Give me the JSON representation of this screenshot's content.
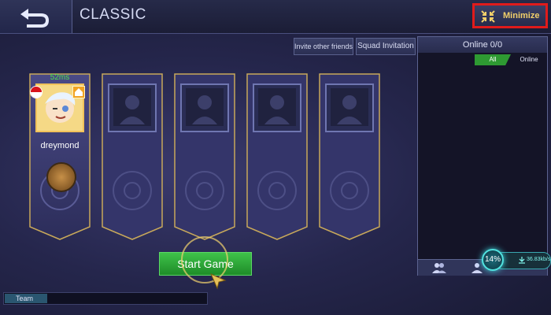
{
  "header": {
    "title": "CLASSIC",
    "minimize_label": "Minimize"
  },
  "invites": {
    "invite_friends_label": "Invite other friends",
    "squad_invitation_label": "Squad Invitation"
  },
  "online_panel": {
    "title": "Online 0/0",
    "tabs": [
      {
        "label": "All",
        "active": true
      },
      {
        "label": "Online",
        "active": false
      }
    ]
  },
  "network": {
    "percent": "14%",
    "speed": "36.83kb/s"
  },
  "lobby": {
    "slots": [
      {
        "filled": true,
        "ping": "52ms",
        "name": "dreymond"
      },
      {
        "filled": false
      },
      {
        "filled": false
      },
      {
        "filled": false
      },
      {
        "filled": false
      }
    ],
    "start_label": "Start Game"
  },
  "chat": {
    "channel_label": "Team"
  },
  "colors": {
    "accent_green": "#2e9a32",
    "highlight_red": "#e01b1b",
    "gold": "#f1cf6a"
  }
}
